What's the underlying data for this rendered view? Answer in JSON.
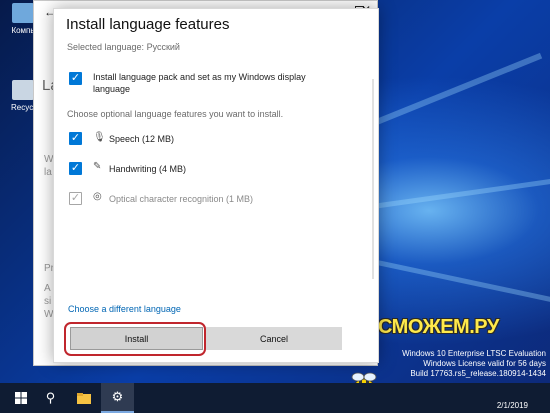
{
  "desktop": {
    "icons": [
      {
        "label": "Компь",
        "icon": "computer-icon"
      },
      {
        "label": "Recycl",
        "icon": "recycle-bin-icon"
      }
    ],
    "watermark": {
      "line1": "Windows 10 Enterprise LTSC Evaluation",
      "line2": "Windows License valid for 56 days",
      "line3": "Build 17763.rs5_release.180914-1434"
    },
    "brand": "СМОЖЕМ.РУ"
  },
  "bg_window": {
    "back_icon": "back-arrow-icon",
    "fragments": [
      "La",
      "W",
      "la",
      "Pr",
      "A",
      "si",
      "W"
    ]
  },
  "dialog": {
    "title": "Install language features",
    "selected_language": "Selected language: Русский",
    "main_option": "Install language pack and set as my Windows display language",
    "hint": "Choose optional language features you want to install.",
    "options": [
      {
        "label": "Speech (12 MB)",
        "icon": "microphone-icon",
        "checked": true,
        "enabled": true
      },
      {
        "label": "Handwriting (4 MB)",
        "icon": "pen-icon",
        "checked": true,
        "enabled": true
      },
      {
        "label": "Optical character recognition (1 MB)",
        "icon": "ocr-icon",
        "checked": true,
        "enabled": false
      }
    ],
    "link": "Choose a different language",
    "install_label": "Install",
    "cancel_label": "Cancel"
  },
  "taskbar": {
    "date": "2/1/2019",
    "items": [
      "start-icon",
      "search-icon",
      "file-explorer-icon",
      "settings-icon"
    ]
  },
  "colors": {
    "accent": "#0078d7",
    "highlight": "#c0262d",
    "link": "#0066b4"
  }
}
